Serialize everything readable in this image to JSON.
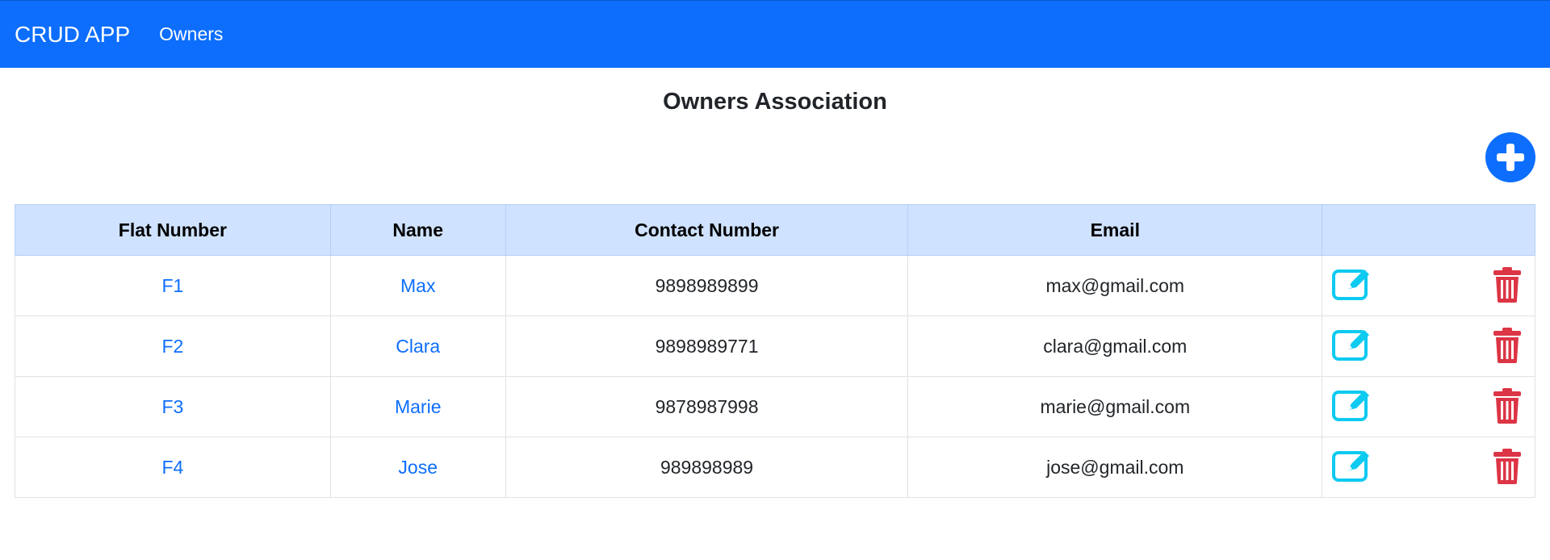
{
  "navbar": {
    "brand": "CRUD APP",
    "link": "Owners"
  },
  "page_title": "Owners Association",
  "colors": {
    "primary": "#0d6efd",
    "header_bg": "#cfe2ff",
    "edit": "#0dcaf0",
    "delete": "#dc3545"
  },
  "icons": {
    "add": "plus-circle-icon",
    "edit": "edit-square-icon",
    "delete": "trash-icon"
  },
  "table": {
    "headers": [
      "Flat Number",
      "Name",
      "Contact Number",
      "Email",
      ""
    ],
    "rows": [
      {
        "flat": "F1",
        "name": "Max",
        "contact": "9898989899",
        "email": "max@gmail.com"
      },
      {
        "flat": "F2",
        "name": "Clara",
        "contact": "9898989771",
        "email": "clara@gmail.com"
      },
      {
        "flat": "F3",
        "name": "Marie",
        "contact": "9878987998",
        "email": "marie@gmail.com"
      },
      {
        "flat": "F4",
        "name": "Jose",
        "contact": "989898989",
        "email": "jose@gmail.com"
      }
    ]
  }
}
